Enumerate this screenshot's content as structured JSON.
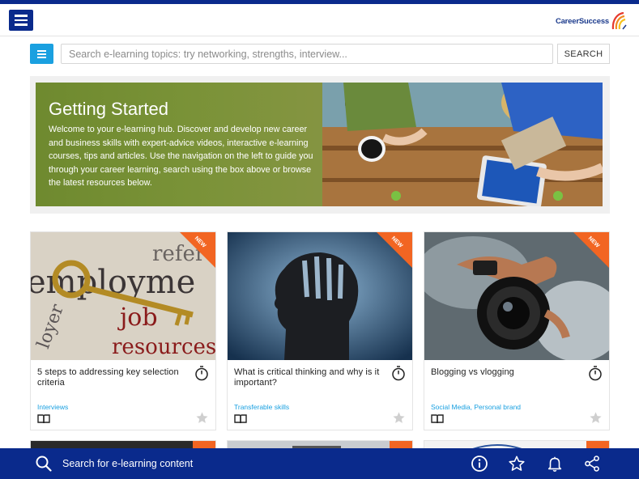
{
  "header": {
    "menu_icon": "hamburger-icon",
    "logo_text": "CareerSuccess"
  },
  "search": {
    "placeholder": "Search e-learning topics: try networking, strengths, interview...",
    "button_label": "SEARCH",
    "side_icon": "list-icon"
  },
  "hero": {
    "title": "Getting Started",
    "body": "Welcome to your e-learning hub. Discover and develop new career and business skills with expert-advice videos, interactive e-learning courses, tips and articles. Use the navigation on the left to guide you through your career learning, search using the box above or browse the latest resources below."
  },
  "cards": [
    {
      "badge": "NEW",
      "title": "5 steps to addressing key selection criteria",
      "category": "Interviews",
      "image": "key-and-employment-words"
    },
    {
      "badge": "NEW",
      "title": "What is critical thinking and why is it important?",
      "category": "Transferable skills",
      "image": "head-silhouette"
    },
    {
      "badge": "NEW",
      "title": "Blogging vs vlogging",
      "category": "Social Media, Personal brand",
      "image": "camera-lens"
    }
  ],
  "bottom_bar": {
    "search_label": "Search for e-learning content",
    "icons": [
      "info-icon",
      "star-icon",
      "bell-icon",
      "share-icon"
    ]
  },
  "colors": {
    "brand_navy": "#0a2a8c",
    "accent_blue": "#1aa0e0",
    "new_badge": "#f26522",
    "hero_green": "#7b9335"
  }
}
